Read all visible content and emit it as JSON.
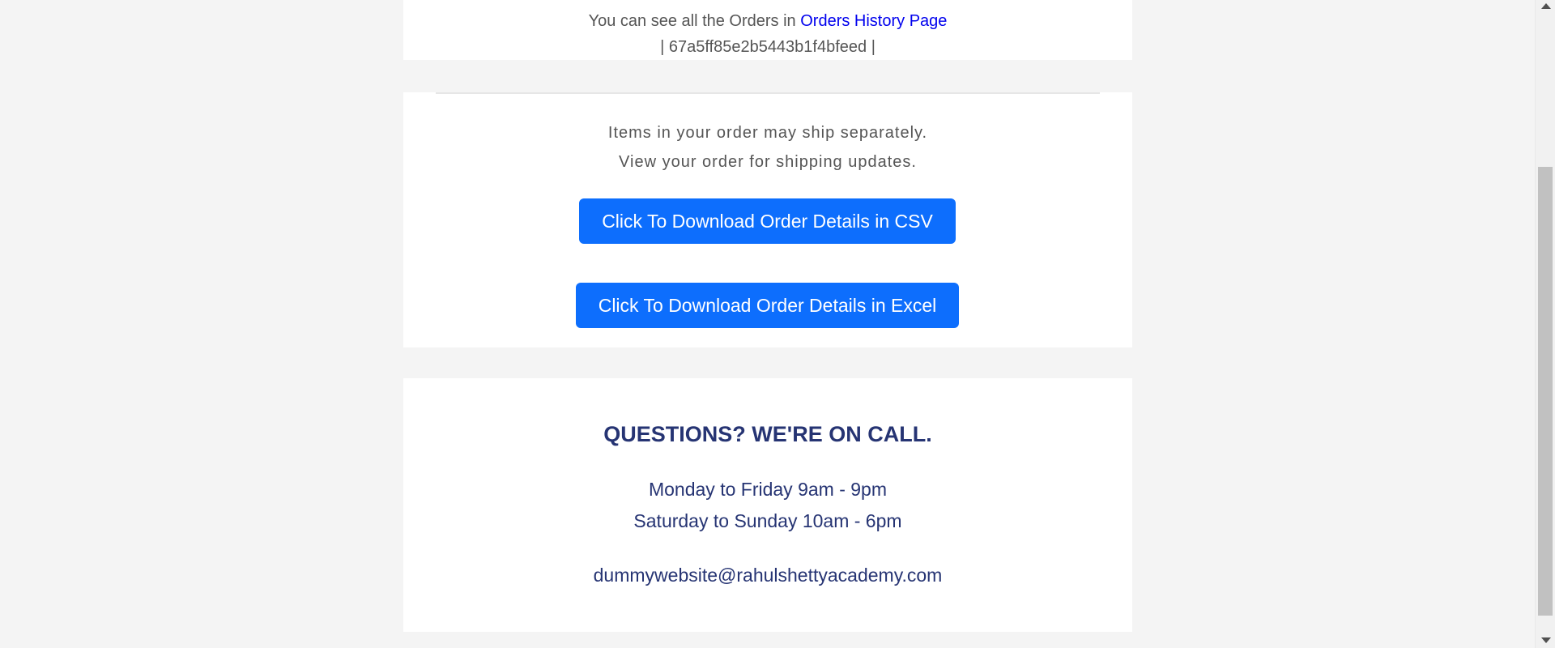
{
  "orders_info": {
    "prefix_text": "You can see all the Orders in ",
    "link_text": "Orders History Page",
    "order_id_line": "| 67a5ff85e2b5443b1f4bfeed |"
  },
  "shipping": {
    "line1": "Items in your order may ship separately.",
    "line2": "View your order for shipping updates."
  },
  "downloads": {
    "csv_label": "Click To Download Order Details in CSV",
    "excel_label": "Click To Download Order Details in Excel"
  },
  "support": {
    "title": "QUESTIONS? WE'RE ON CALL.",
    "hours_weekday": "Monday to Friday 9am - 9pm",
    "hours_weekend": "Saturday to Sunday 10am - 6pm",
    "email": "dummywebsite@rahulshettyacademy.com"
  },
  "colors": {
    "button_bg": "#0d6efd",
    "heading_navy": "#263473",
    "link_blue": "#0000ee",
    "page_bg": "#f4f4f4"
  },
  "icons": {
    "scroll_up": "scroll-up-arrow-icon",
    "scroll_down": "scroll-down-arrow-icon"
  }
}
